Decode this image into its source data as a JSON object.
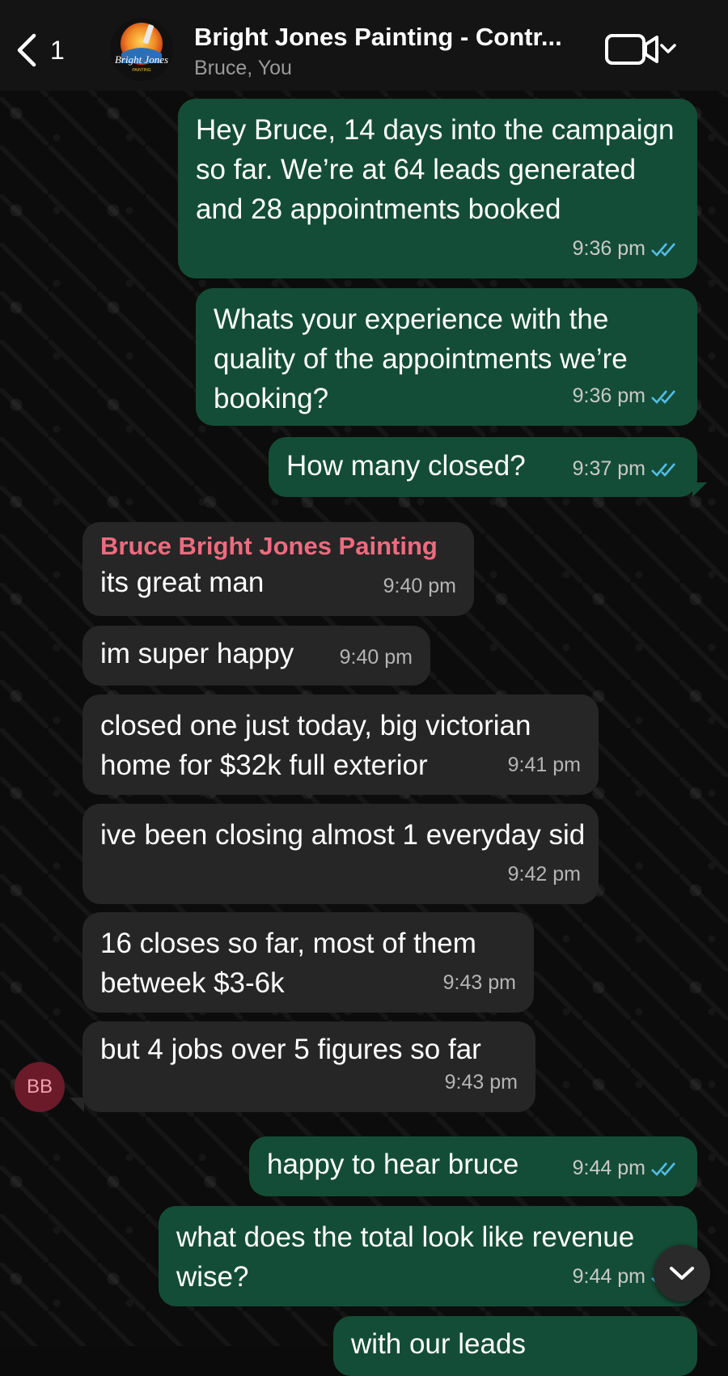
{
  "header": {
    "back_count": "1",
    "title": "Bright Jones Painting - Contr...",
    "subtitle": "Bruce, You",
    "logo_text": "Bright Jones",
    "logo_subtext": "PAINTING"
  },
  "messages": [
    {
      "dir": "out",
      "text": "Hey Bruce, 14 days into the campaign so far. We’re at 64 leads generated and 28 appointments booked",
      "time": "9:36 pm",
      "read": true
    },
    {
      "dir": "out",
      "text": "Whats your experience with the quality of the appointments we’re booking?",
      "time": "9:36 pm",
      "read": true
    },
    {
      "dir": "out",
      "text": "How many closed?",
      "time": "9:37 pm",
      "read": true
    },
    {
      "dir": "in",
      "sender": "Bruce Bright Jones Painting",
      "text": "its great man",
      "time": "9:40 pm"
    },
    {
      "dir": "in",
      "text": "im super happy",
      "time": "9:40 pm"
    },
    {
      "dir": "in",
      "text": "closed one just today, big victorian home for $32k full exterior",
      "time": "9:41 pm"
    },
    {
      "dir": "in",
      "text": "ive been closing almost 1 everyday sid",
      "time": "9:42 pm"
    },
    {
      "dir": "in",
      "text": "16 closes so far, most of them betweek $3-6k",
      "time": "9:43 pm"
    },
    {
      "dir": "in",
      "text": "but 4 jobs over 5 figures so far",
      "time": "9:43 pm"
    },
    {
      "dir": "out",
      "text": "happy to hear bruce",
      "time": "9:44 pm",
      "read": true
    },
    {
      "dir": "out",
      "text": "what does the total look like revenue wise?",
      "time": "9:44 pm",
      "read": true
    },
    {
      "dir": "out",
      "text": "with our leads",
      "time": "",
      "read": true
    }
  ],
  "sender_avatar_initials": "BB",
  "colors": {
    "outgoing_bubble": "#144d37",
    "incoming_bubble": "#262626",
    "sender_name": "#ef6b7f",
    "read_tick": "#53bdeb"
  },
  "icons": {
    "back": "chevron-left-icon",
    "video": "video-camera-icon",
    "dropdown": "chevron-down-icon",
    "scroll_down": "chevron-down-icon",
    "read": "double-check-icon"
  }
}
